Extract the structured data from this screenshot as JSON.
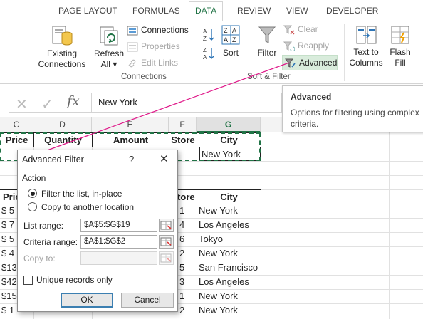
{
  "ribbon": {
    "tabs": [
      "PAGE LAYOUT",
      "FORMULAS",
      "DATA",
      "REVIEW",
      "VIEW",
      "DEVELOPER"
    ],
    "active_tab": "DATA",
    "existing_connections": [
      "Existing",
      "Connections"
    ],
    "refresh_all": [
      "Refresh",
      "All"
    ],
    "refresh_caret": "▾",
    "connections": "Connections",
    "properties": "Properties",
    "edit_links": "Edit Links",
    "group_connections": "Connections",
    "sort": "Sort",
    "filter": "Filter",
    "clear": "Clear",
    "reapply": "Reapply",
    "advanced": "Advanced",
    "group_sort_filter": "Sort & Filter",
    "text_to_columns": [
      "Text to",
      "Columns"
    ],
    "flash_fill": [
      "Flash",
      "Fill"
    ]
  },
  "tooltip": {
    "title": "Advanced",
    "body": "Options for filtering using complex criteria."
  },
  "formula_bar": {
    "cancel": "✕",
    "enter": "✓",
    "fx": "fx",
    "value": "New York"
  },
  "grid": {
    "columns": [
      "C",
      "D",
      "E",
      "F",
      "G"
    ],
    "selected_column": "G",
    "criteria_headers": [
      "Price",
      "Quantity",
      "Amount",
      "Store",
      "City"
    ],
    "criteria_value": "New York",
    "list_headers": {
      "price": "Price",
      "store": "Store",
      "city": "City"
    },
    "rows": [
      {
        "price": "$ 5",
        "store": "1",
        "city": "New York"
      },
      {
        "price": "$ 7",
        "store": "4",
        "city": "Los Angeles"
      },
      {
        "price": "$ 5",
        "store": "6",
        "city": "Tokyo"
      },
      {
        "price": "$ 4",
        "store": "2",
        "city": "New York"
      },
      {
        "price": "$13",
        "store": "5",
        "city": "San Francisco"
      },
      {
        "price": "$42",
        "store": "3",
        "city": "Los Angeles"
      },
      {
        "price": "$15",
        "store": "1",
        "city": "New York"
      },
      {
        "price": "$ 1",
        "store": "2",
        "city": "New York"
      }
    ]
  },
  "dialog": {
    "title": "Advanced Filter",
    "help": "?",
    "close": "✕",
    "action_legend": "Action",
    "filter_in_place": "Filter the list, in-place",
    "copy_to_location": "Copy to another location",
    "list_range_label": "List range:",
    "list_range_value": "$A$5:$G$19",
    "criteria_range_label": "Criteria range:",
    "criteria_range_value": "$A$1:$G$2",
    "copy_to_label": "Copy to:",
    "copy_to_value": "",
    "unique_records": "Unique records only",
    "ok": "OK",
    "cancel": "Cancel"
  },
  "colors": {
    "excel_green": "#217346",
    "callout_line": "#e0198a"
  }
}
